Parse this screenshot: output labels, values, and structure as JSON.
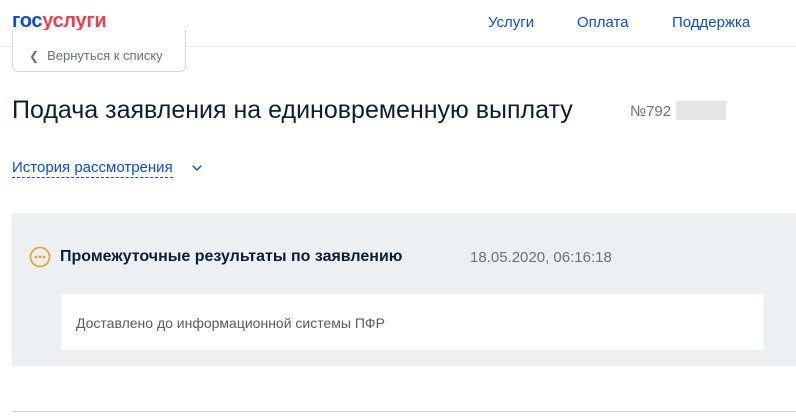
{
  "header": {
    "logo": {
      "part1": "гос",
      "part2": "услуги"
    },
    "nav": [
      {
        "label": "Услуги"
      },
      {
        "label": "Оплата"
      },
      {
        "label": "Поддержка"
      }
    ]
  },
  "back_button": {
    "label": "Вернуться к списку"
  },
  "application": {
    "title": "Подача заявления на единовременную выплату",
    "number_prefix": "№792"
  },
  "history": {
    "label": "История рассмотрения"
  },
  "status": {
    "title": "Промежуточные результаты по заявлению",
    "datetime": "18.05.2020, 06:16:18",
    "message": "Доставлено до информационной системы ПФР"
  },
  "colors": {
    "brand_blue": "#0d4cd3",
    "brand_red": "#ee3f58",
    "status_pending": "#e8a72b",
    "panel_bg": "#edf0f2"
  },
  "icons": {
    "back": "chevron-left-icon",
    "history": "chevron-down-icon",
    "status": "pending-dots-icon"
  }
}
